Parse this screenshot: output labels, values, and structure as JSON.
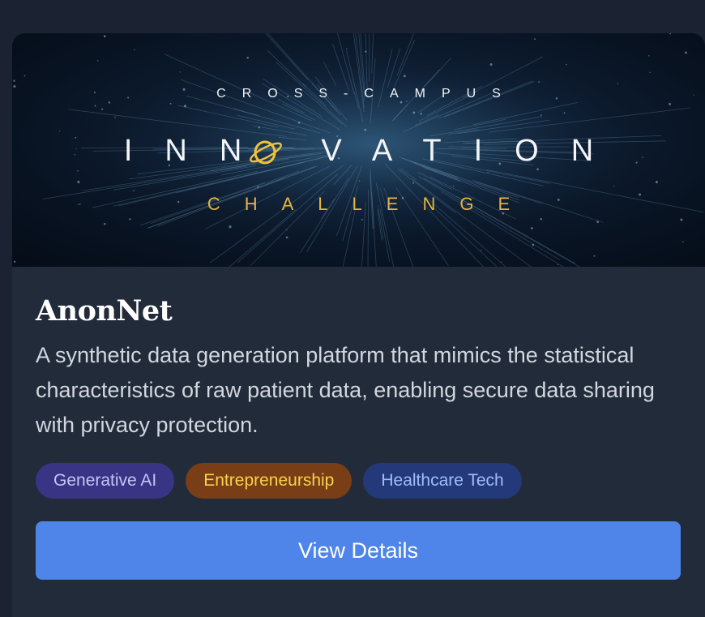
{
  "banner": {
    "line1": "CROSS-CAMPUS",
    "line2_left": "INN",
    "line2_right": "VATION",
    "line3": "CHALLENGE",
    "orbit_icon": "orbit-o-icon"
  },
  "project": {
    "title": "AnonNet",
    "description": "A synthetic data generation platform that mimics the statistical characteristics of raw patient data, enabling secure data sharing with privacy protection."
  },
  "tags": [
    {
      "label": "Generative AI",
      "bg": "#3a3485",
      "fg": "#c5c2f5"
    },
    {
      "label": "Entrepreneurship",
      "bg": "#7a3e17",
      "fg": "#f7d24e"
    },
    {
      "label": "Healthcare Tech",
      "bg": "#24397a",
      "fg": "#9fbdf8"
    }
  ],
  "actions": {
    "view_details_label": "View Details"
  },
  "colors": {
    "page_bg": "#1b2231",
    "card_bg": "#222b3a",
    "accent_button": "#4f85e8",
    "banner_gold": "#e4b53e"
  }
}
